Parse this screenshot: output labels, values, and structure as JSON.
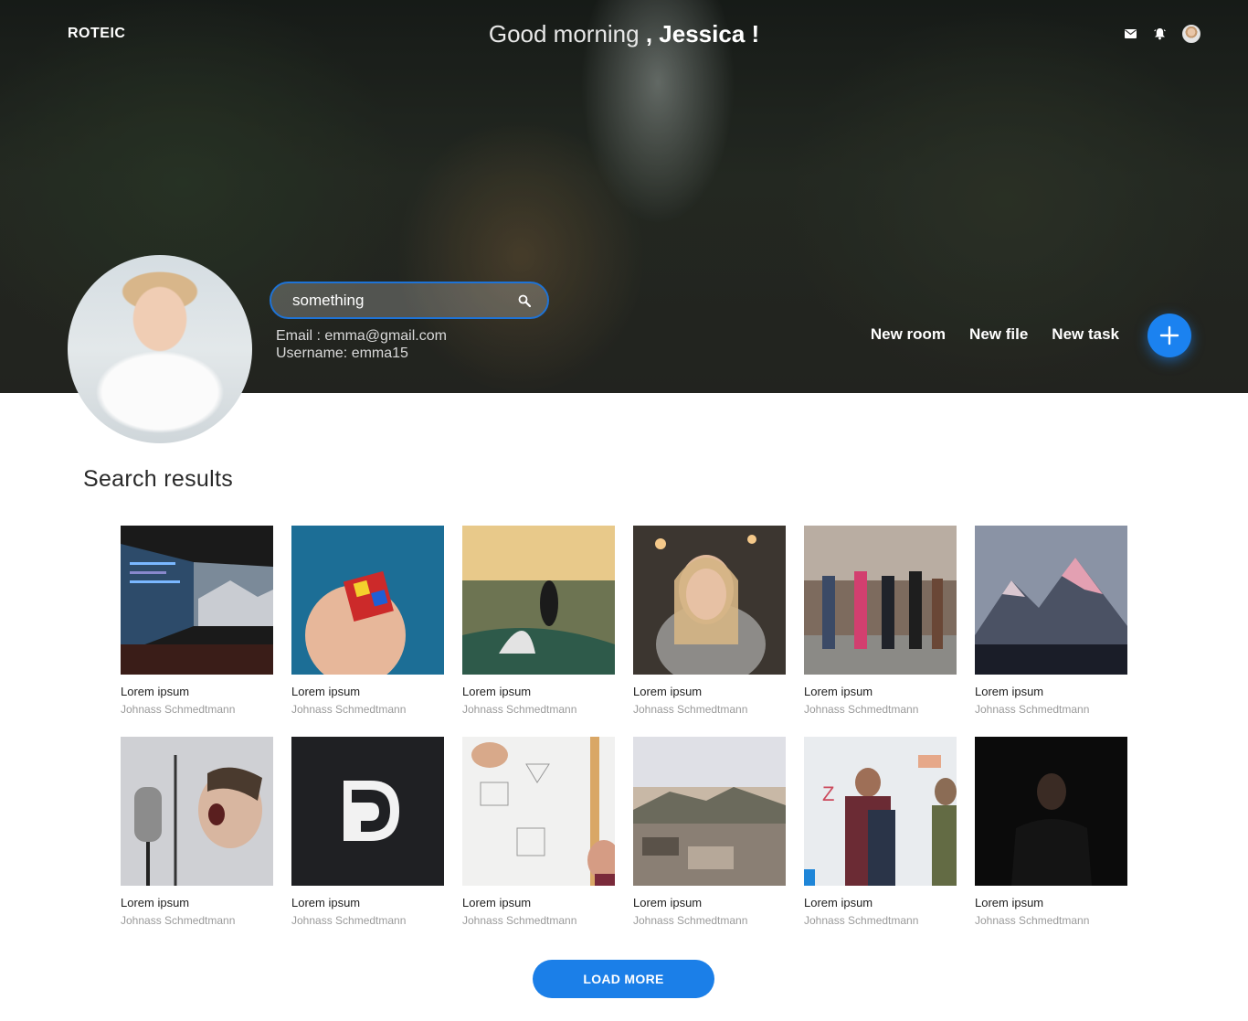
{
  "header": {
    "brand": "ROTEIC",
    "greeting_prefix": "Good morning",
    "greeting_name": ", Jessica !",
    "icons": [
      "mail-icon",
      "bell-icon",
      "user-avatar"
    ]
  },
  "profile": {
    "search": {
      "value": "something",
      "placeholder": ""
    },
    "email_line": "Email : emma@gmail.com",
    "username_line": "Username: emma15"
  },
  "actions": {
    "new_room": "New room",
    "new_file": "New file",
    "new_task": "New task",
    "fab_icon": "plus-icon"
  },
  "results": {
    "title": "Search results",
    "items": [
      {
        "title": "Lorem ipsum",
        "author": "Johnass Schmedtmann"
      },
      {
        "title": "Lorem ipsum",
        "author": "Johnass Schmedtmann"
      },
      {
        "title": "Lorem ipsum",
        "author": "Johnass Schmedtmann"
      },
      {
        "title": "Lorem ipsum",
        "author": "Johnass Schmedtmann"
      },
      {
        "title": "Lorem ipsum",
        "author": "Johnass Schmedtmann"
      },
      {
        "title": "Lorem ipsum",
        "author": "Johnass Schmedtmann"
      },
      {
        "title": "Lorem ipsum",
        "author": "Johnass Schmedtmann"
      },
      {
        "title": "Lorem ipsum",
        "author": "Johnass Schmedtmann"
      },
      {
        "title": "Lorem ipsum",
        "author": "Johnass Schmedtmann"
      },
      {
        "title": "Lorem ipsum",
        "author": "Johnass Schmedtmann"
      },
      {
        "title": "Lorem ipsum",
        "author": "Johnass Schmedtmann"
      },
      {
        "title": "Lorem ipsum",
        "author": "Johnass Schmedtmann"
      }
    ],
    "load_more": "LOAD MORE"
  },
  "colors": {
    "accent": "#1b7fe8",
    "search_border": "#1e73d6"
  }
}
